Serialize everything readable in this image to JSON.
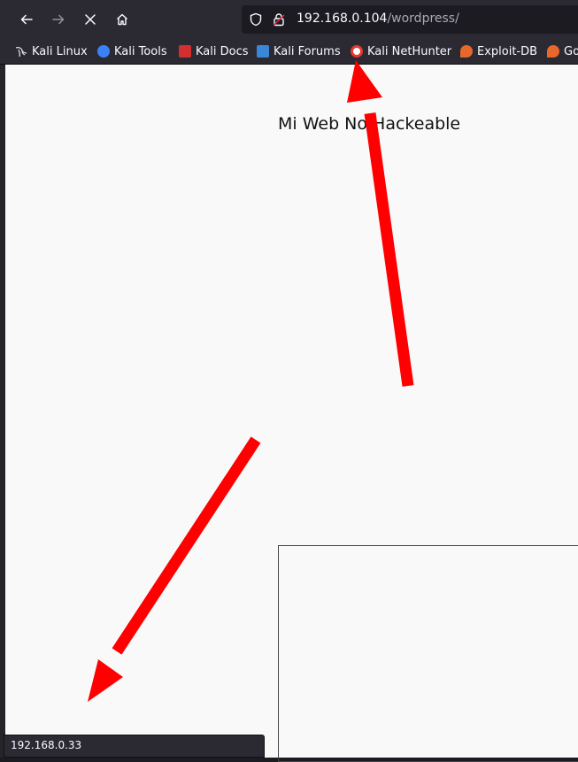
{
  "browser": {
    "url_host": "192.168.0.104",
    "url_path": "/wordpress/"
  },
  "bookmarks": [
    {
      "label": "Kali Linux",
      "icon": "kali-dragon-icon",
      "color": "#1b1b1b"
    },
    {
      "label": "Kali Tools",
      "icon": "kali-tools-icon",
      "color": "#3b82f6"
    },
    {
      "label": "Kali Docs",
      "icon": "kali-docs-icon",
      "color": "#d32f2f"
    },
    {
      "label": "Kali Forums",
      "icon": "kali-forums-icon",
      "color": "#3a86d8"
    },
    {
      "label": "Kali NetHunter",
      "icon": "nethunter-icon",
      "color": "#e53935"
    },
    {
      "label": "Exploit-DB",
      "icon": "exploit-db-icon",
      "color": "#e8672a"
    },
    {
      "label": "Go",
      "icon": "ghdb-icon",
      "color": "#e8672a"
    }
  ],
  "page": {
    "site_title": "Mi Web No Hackeable"
  },
  "status": {
    "link_url": "192.168.0.33"
  },
  "annotation_color": "#ff0000"
}
